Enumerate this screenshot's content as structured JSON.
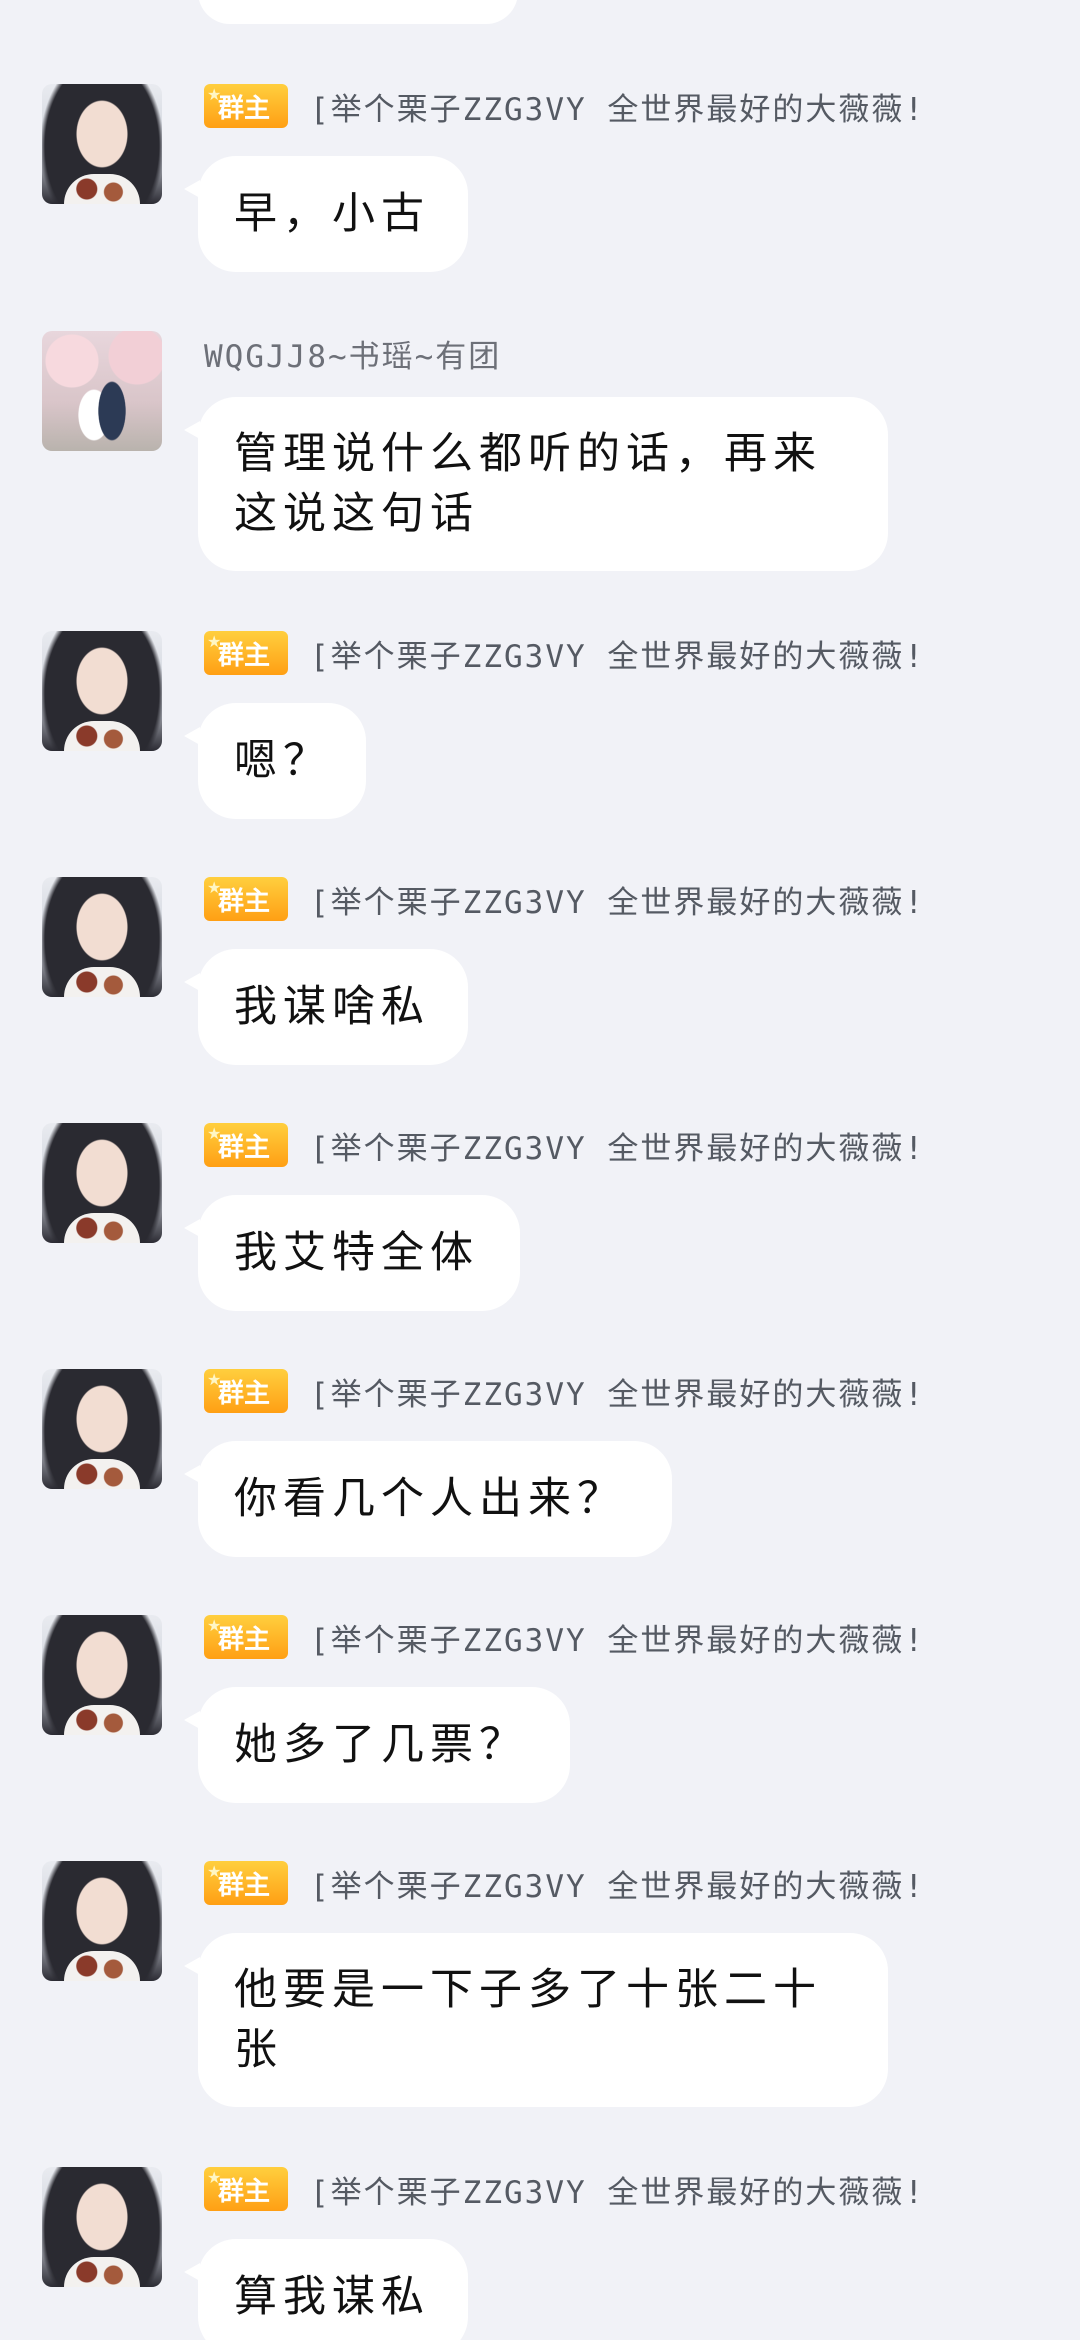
{
  "group_owner_badge": "群主",
  "owner_name": "[举个栗子ZZG3VY 全世界最好的大薇薇!",
  "member_name": "WQGJJ8~书瑶~有团",
  "messages": [
    {
      "sender_type": "owner",
      "text": "早，小古"
    },
    {
      "sender_type": "member",
      "text": "管理说什么都听的话，再来这说这句话"
    },
    {
      "sender_type": "owner",
      "text": "嗯？"
    },
    {
      "sender_type": "owner",
      "text": "我谋啥私"
    },
    {
      "sender_type": "owner",
      "text": "我艾特全体"
    },
    {
      "sender_type": "owner",
      "text": "你看几个人出来？"
    },
    {
      "sender_type": "owner",
      "text": "她多了几票？"
    },
    {
      "sender_type": "owner",
      "text": "他要是一下子多了十张二十张"
    },
    {
      "sender_type": "owner",
      "text": "算我谋私"
    }
  ]
}
